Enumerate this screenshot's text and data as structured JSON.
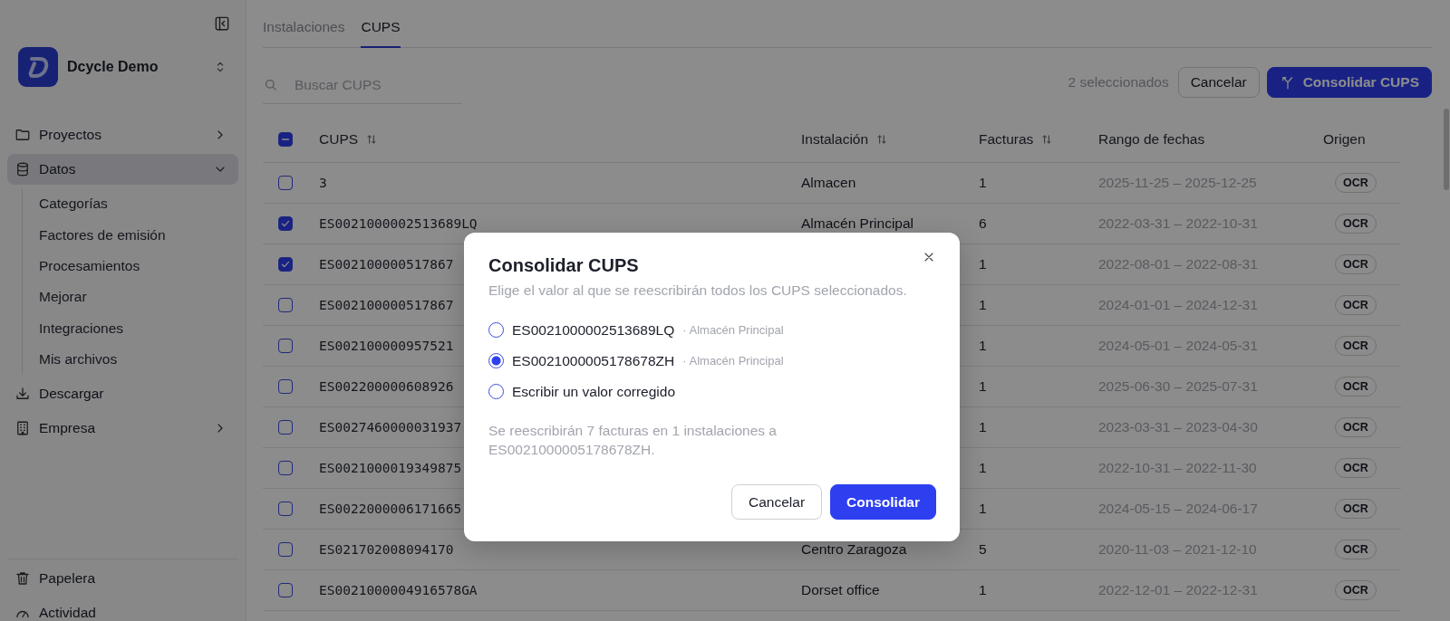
{
  "sidebar": {
    "org": {
      "name": "Dcycle Demo"
    },
    "items": [
      {
        "label": "Proyectos",
        "expanded": false,
        "selected": false
      },
      {
        "label": "Datos",
        "expanded": true,
        "selected": true,
        "children": [
          {
            "label": "Categorías"
          },
          {
            "label": "Factores de emisión"
          },
          {
            "label": "Procesamientos"
          },
          {
            "label": "Mejorar"
          },
          {
            "label": "Integraciones"
          },
          {
            "label": "Mis archivos"
          }
        ]
      },
      {
        "label": "Descargar",
        "selected": false
      },
      {
        "label": "Empresa",
        "expanded": false,
        "selected": false
      }
    ],
    "footer_items": [
      {
        "label": "Papelera"
      },
      {
        "label": "Actividad"
      }
    ]
  },
  "tabs": [
    {
      "label": "Instalaciones",
      "selected": false
    },
    {
      "label": "CUPS",
      "selected": true
    }
  ],
  "search": {
    "placeholder": "Buscar CUPS"
  },
  "selection": {
    "count_label": "2 seleccionados",
    "cancel": "Cancelar",
    "action": "Consolidar CUPS"
  },
  "table": {
    "header_checkbox": {
      "indeterminate": true
    },
    "columns": [
      {
        "label": "CUPS",
        "sortable": true
      },
      {
        "label": "Instalación",
        "sortable": true
      },
      {
        "label": "Facturas",
        "sortable": true
      },
      {
        "label": "Rango de fechas",
        "sortable": false
      },
      {
        "label": "Origen",
        "sortable": false
      }
    ],
    "rows": [
      {
        "cups": "3",
        "installation": "Almacen",
        "invoices": "1",
        "dates": "2025-11-25 – 2025-12-25",
        "origin": "OCR",
        "checked": false
      },
      {
        "cups": "ES0021000002513689LQ",
        "installation": "Almacén Principal",
        "invoices": "6",
        "dates": "2022-03-31 – 2022-10-31",
        "origin": "OCR",
        "checked": true
      },
      {
        "cups": "ES002100000517867",
        "invoices": "1",
        "dates": "2022-08-01 – 2022-08-31",
        "origin": "OCR",
        "checked": true
      },
      {
        "cups": "ES002100000517867",
        "invoices": "1",
        "dates": "2024-01-01 – 2024-12-31",
        "origin": "OCR",
        "checked": false
      },
      {
        "cups": "ES002100000957521",
        "invoices": "1",
        "dates": "2024-05-01 – 2024-05-31",
        "origin": "OCR",
        "checked": false
      },
      {
        "cups": "ES002200000608926",
        "invoices": "1",
        "dates": "2025-06-30 – 2025-07-31",
        "origin": "OCR",
        "checked": false
      },
      {
        "cups": "ES0027460000031937",
        "invoices": "1",
        "dates": "2023-03-31 – 2023-04-30",
        "origin": "OCR",
        "checked": false
      },
      {
        "cups": "ES0021000019349875",
        "invoices": "1",
        "dates": "2022-10-31 – 2022-11-30",
        "origin": "OCR",
        "checked": false
      },
      {
        "cups": "ES0022000006171665",
        "invoices": "1",
        "dates": "2024-05-15 – 2024-06-17",
        "origin": "OCR",
        "checked": false
      },
      {
        "cups": "ES021702008094170",
        "installation": "Centro Zaragoza",
        "invoices": "5",
        "dates": "2020-11-03 – 2021-12-10",
        "origin": "OCR",
        "checked": false
      },
      {
        "cups": "ES0021000004916578GA",
        "installation": "Dorset office",
        "invoices": "1",
        "dates": "2022-12-01 – 2022-12-31",
        "origin": "OCR",
        "checked": false
      }
    ]
  },
  "dialog": {
    "title": "Consolidar CUPS",
    "subtitle": "Elige el valor al que se reescribirán todos los CUPS seleccionados.",
    "options": [
      {
        "kind": "value",
        "label": "ES0021000002513689LQ",
        "note": "· Almacén Principal",
        "selected": false
      },
      {
        "kind": "value",
        "label": "ES0021000005178678ZH",
        "note": "· Almacén Principal",
        "selected": true
      },
      {
        "kind": "custom",
        "label": "Escribir un valor corregido",
        "selected": false
      }
    ],
    "summary": "Se reescribirán 7 facturas en 1 instalaciones a ES0021000005178678ZH.",
    "buttons": [
      {
        "kind": "secondary",
        "label": "Cancelar"
      },
      {
        "kind": "primary",
        "label": "Consolidar"
      }
    ]
  }
}
